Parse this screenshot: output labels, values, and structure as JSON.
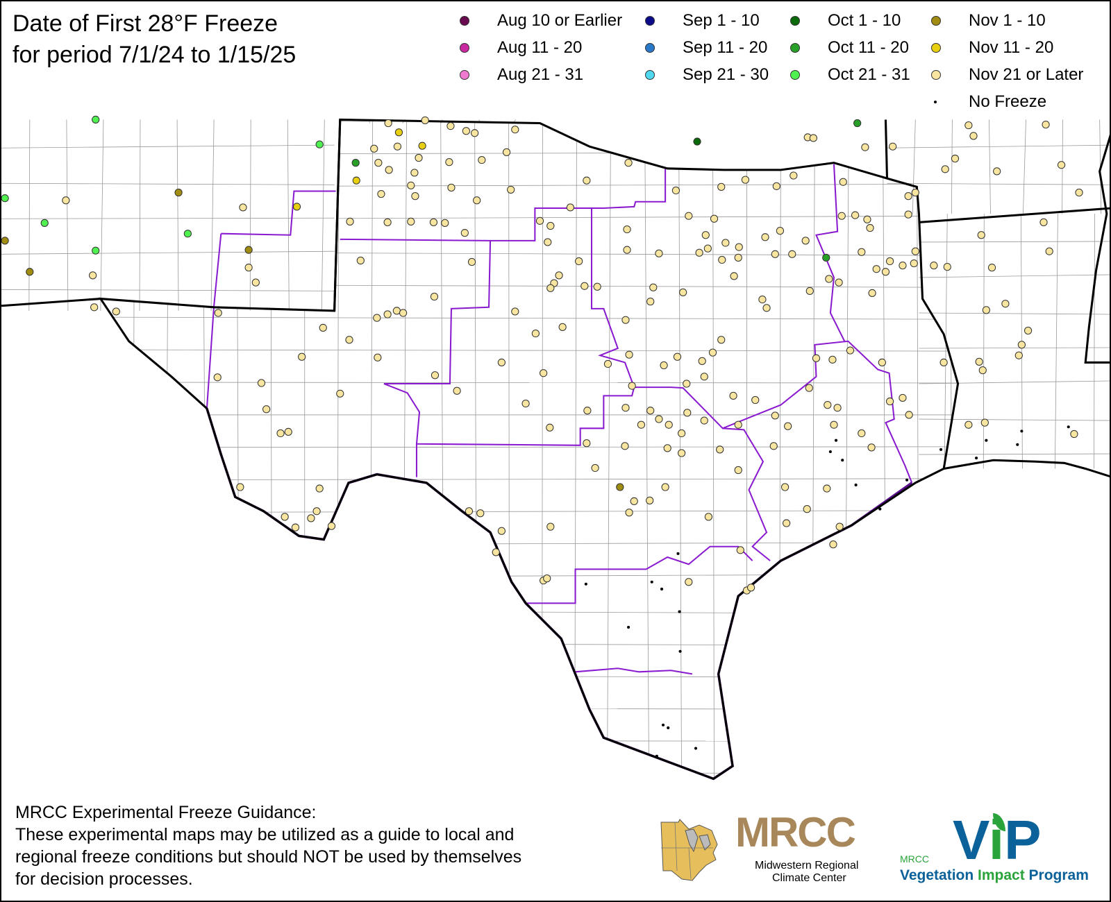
{
  "title": {
    "line1": "Date of First 28°F Freeze",
    "line2": "for period 7/1/24 to 1/15/25"
  },
  "legend": [
    {
      "label": "Aug 10 or Earlier",
      "color": "#6a0a4f"
    },
    {
      "label": "Aug 11 - 20",
      "color": "#c829a0"
    },
    {
      "label": "Aug 21 - 31",
      "color": "#f07ad0"
    },
    {
      "label": "Sep 1 - 10",
      "color": "#0a0a8a"
    },
    {
      "label": "Sep 11 - 20",
      "color": "#2a78c8"
    },
    {
      "label": "Sep 21 - 30",
      "color": "#50d8f0"
    },
    {
      "label": "Oct 1 - 10",
      "color": "#0a6a0a"
    },
    {
      "label": "Oct 11 - 20",
      "color": "#28a028"
    },
    {
      "label": "Oct 21 - 31",
      "color": "#50f050"
    },
    {
      "label": "Nov 1 - 10",
      "color": "#a08c10"
    },
    {
      "label": "Nov 11 - 20",
      "color": "#e8d010"
    },
    {
      "label": "Nov 21 or Later",
      "color": "#f8e6a0"
    },
    {
      "label": "No Freeze",
      "color": "#000000"
    }
  ],
  "disclaimer": {
    "heading": "MRCC Experimental Freeze Guidance:",
    "line1": "These experimental maps may be utilized as a guide to local and",
    "line2": "regional freeze conditions but should NOT be used by themselves",
    "line3": "for decision processes."
  },
  "logos": {
    "mrcc": {
      "abbr": "MRCC",
      "line1": "Midwestern Regional",
      "line2": "Climate Center",
      "color": "#a8875a"
    },
    "vip": {
      "small": "MRCC",
      "abbr_v": "V",
      "abbr_i": "i",
      "abbr_p": "P",
      "name_a": "Vegetation ",
      "name_b": "Impact",
      "name_c": " Program",
      "blue": "#0b6199",
      "green": "#2aa33a"
    }
  },
  "colors": {
    "state_border": "#000000",
    "division_border": "#8a1ad0",
    "county_border": "#9a9a9a"
  }
}
